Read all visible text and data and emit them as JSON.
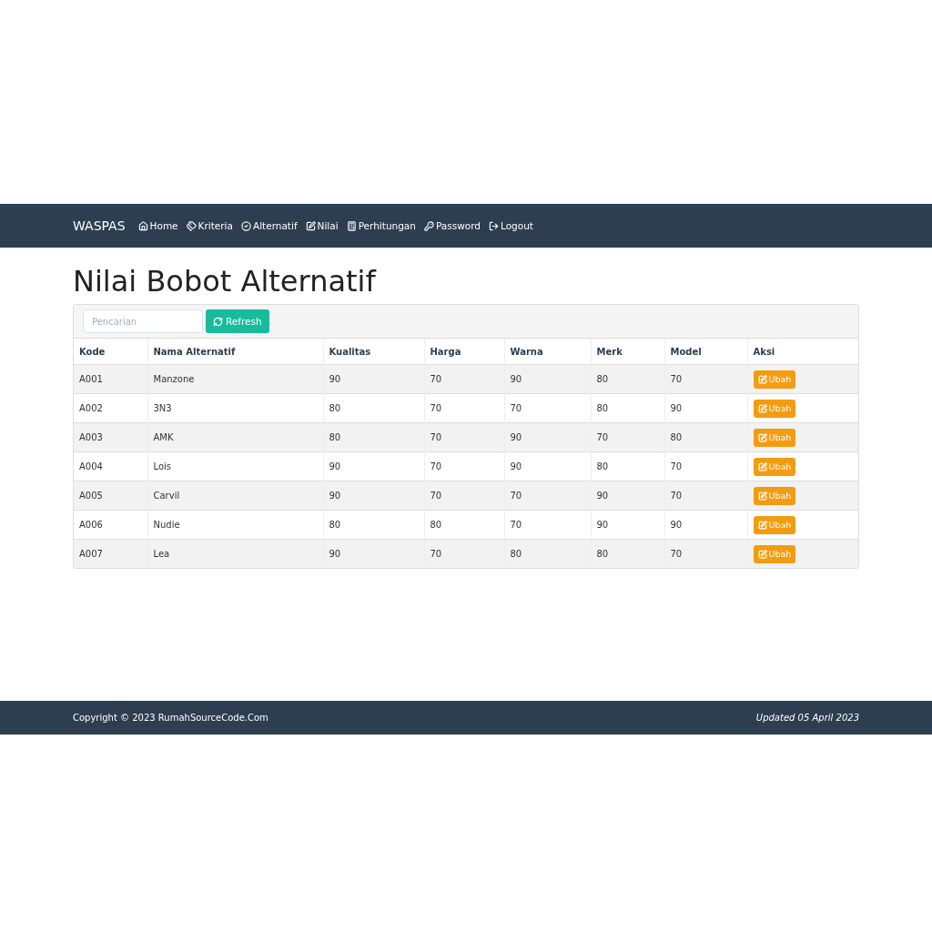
{
  "navbar": {
    "brand": "WASPAS",
    "items": [
      {
        "label": "Home"
      },
      {
        "label": "Kriteria"
      },
      {
        "label": "Alternatif"
      },
      {
        "label": "Nilai"
      },
      {
        "label": "Perhitungan"
      },
      {
        "label": "Password"
      },
      {
        "label": "Logout"
      }
    ]
  },
  "page_title": "Nilai Bobot Alternatif",
  "toolbar": {
    "search": {
      "placeholder": "Pencarian"
    },
    "refresh_button": "Refresh"
  },
  "table": {
    "columns": [
      "Kode",
      "Nama Alternatif",
      "Kualitas",
      "Harga",
      "Warna",
      "Merk",
      "Model",
      "Aksi"
    ],
    "rows": [
      {
        "cells": [
          "A001",
          "Manzone",
          "90",
          "70",
          "90",
          "80",
          "70"
        ],
        "action": "Ubah"
      },
      {
        "cells": [
          "A002",
          "3N3",
          "80",
          "70",
          "70",
          "80",
          "90"
        ],
        "action": "Ubah"
      },
      {
        "cells": [
          "A003",
          "AMK",
          "80",
          "70",
          "90",
          "70",
          "80"
        ],
        "action": "Ubah"
      },
      {
        "cells": [
          "A004",
          "Lois",
          "90",
          "70",
          "90",
          "80",
          "70"
        ],
        "action": "Ubah"
      },
      {
        "cells": [
          "A005",
          "Carvil",
          "90",
          "70",
          "70",
          "90",
          "70"
        ],
        "action": "Ubah"
      },
      {
        "cells": [
          "A006",
          "Nudie",
          "80",
          "80",
          "70",
          "90",
          "90"
        ],
        "action": "Ubah"
      },
      {
        "cells": [
          "A007",
          "Lea",
          "90",
          "70",
          "80",
          "80",
          "70"
        ],
        "action": "Ubah"
      }
    ]
  },
  "footer": {
    "copyright": "Copyright © 2023 RumahSourceCode.Com",
    "updated": "Updated 05 April 2023"
  }
}
